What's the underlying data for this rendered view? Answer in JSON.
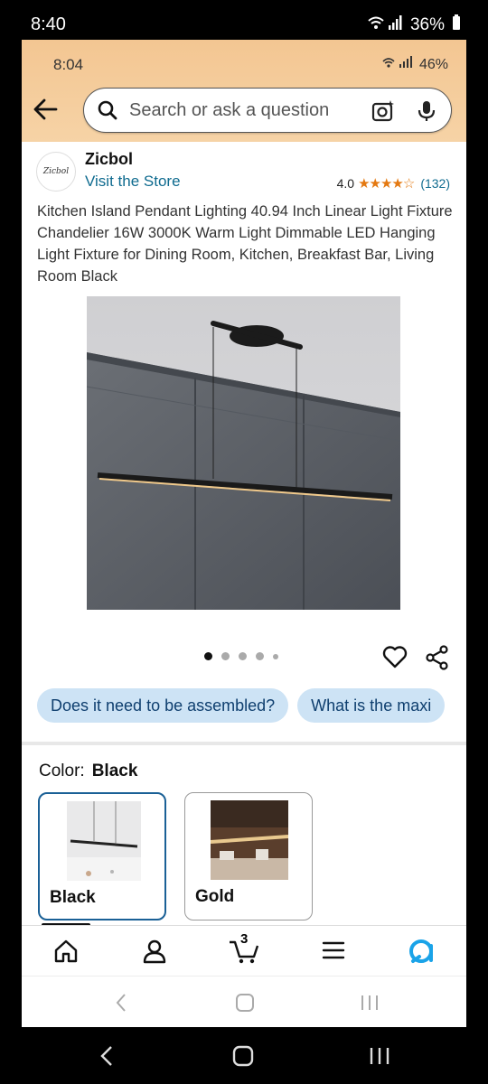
{
  "outer_status": {
    "time": "8:40",
    "battery": "36%"
  },
  "inner_status": {
    "time": "8:04",
    "battery": "46%"
  },
  "search": {
    "placeholder": "Search or ask a question"
  },
  "brand": {
    "logo_text": "Zicbol",
    "name": "Zicbol",
    "visit": "Visit the Store"
  },
  "rating": {
    "value": "4.0",
    "stars": 4,
    "count": "(132)"
  },
  "product": {
    "title": "Kitchen Island Pendant Lighting 40.94 Inch Linear Light Fixture Chandelier 16W 3000K Warm Light Dimmable LED Hanging Light Fixture for Dining Room, Kitchen, Breakfast Bar, Living Room Black"
  },
  "questions": [
    "Does it need to be assembled?",
    "What is the maxi"
  ],
  "color": {
    "label": "Color:",
    "selected": "Black",
    "options": [
      "Black",
      "Gold"
    ]
  },
  "cart": {
    "count": "3"
  },
  "colors": {
    "header": "#f3c692",
    "link": "#0f6b8f",
    "chip": "#cde3f5",
    "star": "#e47911",
    "selected_border": "#1a6096"
  },
  "icons": [
    "back-arrow-icon",
    "search-icon",
    "camera-icon",
    "mic-icon",
    "heart-icon",
    "share-icon",
    "home-icon",
    "profile-icon",
    "cart-icon",
    "menu-icon",
    "alexa-icon"
  ]
}
